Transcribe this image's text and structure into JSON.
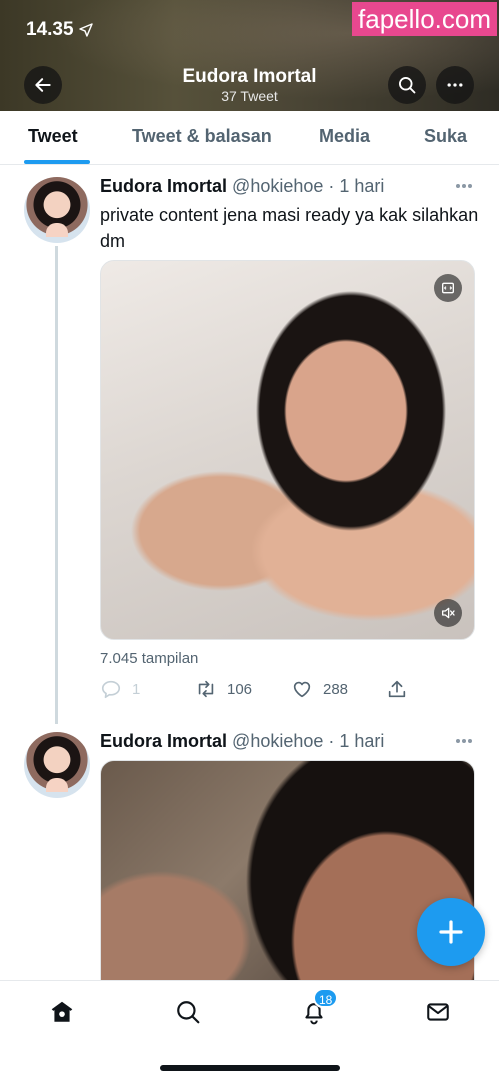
{
  "status_bar": {
    "time": "14.35"
  },
  "watermark": "fapello.com",
  "header": {
    "title": "Eudora Imortal",
    "subtitle": "37 Tweet"
  },
  "tabs": [
    {
      "label": "Tweet",
      "active": true
    },
    {
      "label": "Tweet & balasan",
      "active": false
    },
    {
      "label": "Media",
      "active": false
    },
    {
      "label": "Suka",
      "active": false
    }
  ],
  "tweets": [
    {
      "name": "Eudora Imortal",
      "handle": "@hokiehoe",
      "time": "· 1 hari",
      "text": "private content jena masi ready ya kak silahkan dm",
      "views": "7.045 tampilan",
      "replies": "1",
      "retweets": "106",
      "likes": "288"
    },
    {
      "name": "Eudora Imortal",
      "handle": "@hokiehoe",
      "time": "· 1 hari"
    }
  ],
  "bottom_nav": {
    "notifications_badge": "18"
  },
  "colors": {
    "accent": "#1d9bf0",
    "text": "#0f1419",
    "secondary": "#536471",
    "watermark_bg": "#e8488f"
  },
  "icons": [
    "location-arrow-icon",
    "back-arrow-icon",
    "search-icon",
    "more-icon",
    "embed-icon",
    "mute-icon",
    "reply-icon",
    "retweet-icon",
    "like-icon",
    "share-icon",
    "compose-plus-icon",
    "home-icon",
    "explore-icon",
    "notifications-icon",
    "messages-icon"
  ]
}
